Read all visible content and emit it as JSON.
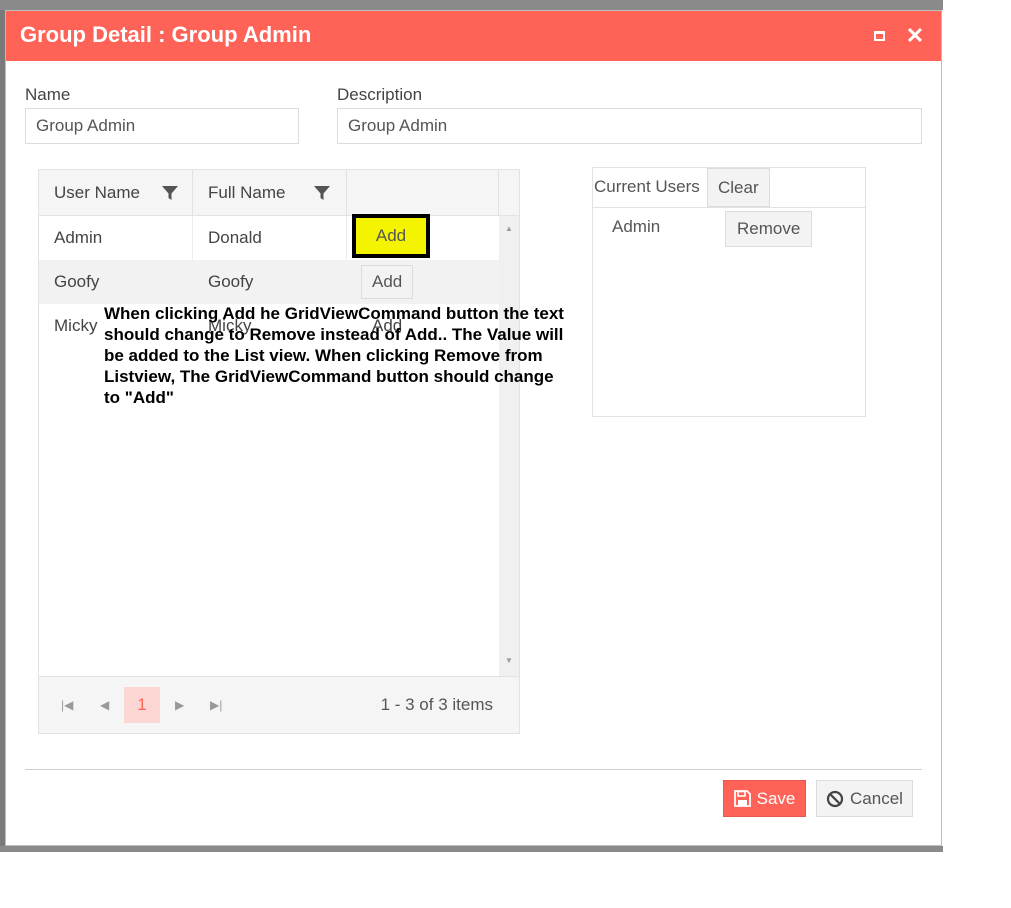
{
  "window": {
    "title": "Group Detail : Group Admin",
    "accent_color": "#ff6358"
  },
  "form": {
    "name_label": "Name",
    "name_value": "Group Admin",
    "description_label": "Description",
    "description_value": "Group Admin"
  },
  "grid": {
    "columns": [
      "User Name",
      "Full Name"
    ],
    "rows": [
      {
        "user_name": "Admin",
        "full_name": "Donald",
        "command": "Add"
      },
      {
        "user_name": "Goofy",
        "full_name": "Goofy",
        "command": "Add"
      },
      {
        "user_name": "Micky",
        "full_name": "Micky",
        "command": "Add"
      }
    ],
    "pager": {
      "current_page": "1",
      "info": "1 - 3 of 3 items"
    }
  },
  "annotation": "When clicking Add he GridViewCommand button the text should change to Remove instead of Add.. The Value will be added to the List view. When clicking Remove from Listview, The GridViewCommand button should change to \"Add\"",
  "listview": {
    "title": "Current Users",
    "clear_label": "Clear",
    "items": [
      {
        "name": "Admin",
        "action": "Remove"
      }
    ]
  },
  "footer": {
    "save_label": "Save",
    "cancel_label": "Cancel"
  }
}
